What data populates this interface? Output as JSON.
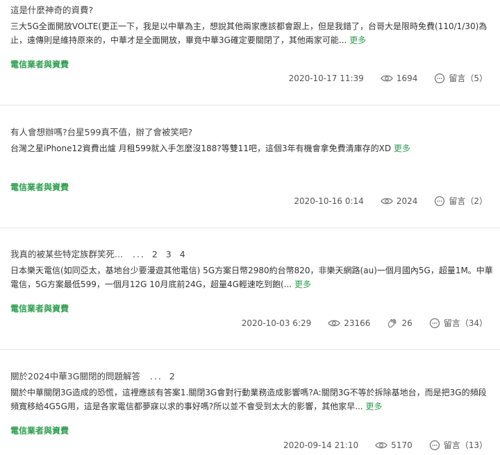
{
  "posts": [
    {
      "title": "這是什麼神奇的資費?",
      "excerpt": "三大5G全面開放VOLTE(更正一下，我是以中華為主，想說其他兩家應該都會跟上，但是我錯了，台哥大是限時免費(110/1/30)為止，遠傳則是維持原來的，中華才是全面開放，畢竟中華3G確定要關閉了，其他兩家可能...",
      "more": "更多",
      "category": "電信業者與資費",
      "date": "2020-10-17 11:39",
      "views": "1694",
      "comments": "留言（5）"
    },
    {
      "title": "有人會想辦嗎?台星599真不值，辦了會被笑吧?",
      "excerpt": "台灣之星iPhone12資費出爐 月租599就入手怎麼沒188?等雙11吧，這個3年有機會拿免費清庫存的XD",
      "more": "更多",
      "category": "電信業者與資費",
      "date": "2020-10-16 0:14",
      "views": "2024",
      "comments": "留言（2）"
    },
    {
      "title": "我真的被某些特定族群笑死...",
      "pages": [
        "...",
        "2",
        "3",
        "4"
      ],
      "excerpt": "日本樂天電信(如同亞太，基地台少要漫遊其他電信) 5G方案日幣2980約台幣820，非樂天網路(au)一個月國內5G，超量1M。中華電信，5G方案最低599，一個月12G 10月底前24G，超量4G輕速吃到飽(...",
      "more": "更多",
      "category": "電信業者與資費",
      "date": "2020-10-03 6:29",
      "views": "23166",
      "likes": "26",
      "comments": "留言（34）"
    },
    {
      "title": "關於2024中華3G關閉的問題解答",
      "pages": [
        "...",
        "2"
      ],
      "excerpt": "關於中華關閉3G造成的恐慌，這裡應該有答案1.關閉3G會對行動業務造成影響嗎?A:關閉3G不等於拆除基地台，而是把3G的頻段頻寬移給4G5G用，這是各家電信都夢寐以求的事好嗎?所以並不會受到太大的影響，其他家早...",
      "more": "更多",
      "category": "電信業者與資費",
      "date": "2020-09-14 21:10",
      "views": "5170",
      "comments": "留言（13）"
    }
  ],
  "colors": {
    "accent": "#2e9e4f",
    "divider": "#e6e6e6",
    "text": "#333333",
    "meta": "#555555"
  },
  "icons": {
    "views": "eye-icon",
    "likes": "clap-icon",
    "comments": "comment-icon"
  }
}
